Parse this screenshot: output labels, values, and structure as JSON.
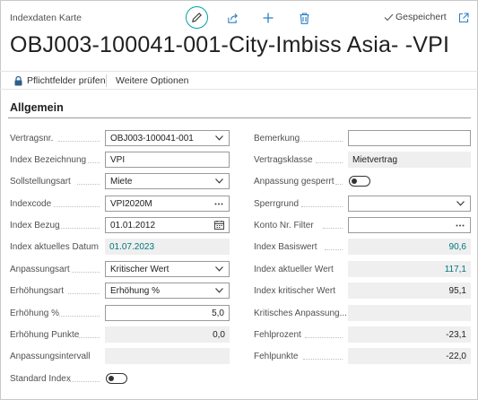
{
  "header": {
    "caption": "Indexdaten Karte",
    "saved_status": "Gespeichert",
    "title": "OBJ003-100041-001-City-Imbiss Asia- -VPI"
  },
  "actions": {
    "check_required": "Pflichtfelder prüfen",
    "more_options": "Weitere Optionen"
  },
  "group": {
    "title": "Allgemein"
  },
  "left_fields": {
    "vertragsnr": {
      "label": "Vertragsnr.",
      "value": "OBJ003-100041-001"
    },
    "index_bezeichnung": {
      "label": "Index Bezeichnung",
      "value": "VPI"
    },
    "sollstellungsart": {
      "label": "Sollstellungsart",
      "value": "Miete"
    },
    "indexcode": {
      "label": "Indexcode",
      "value": "VPI2020M"
    },
    "index_bezug": {
      "label": "Index Bezug",
      "value": "01.01.2012"
    },
    "index_aktuelles_datum": {
      "label": "Index aktuelles Datum",
      "value": "01.07.2023"
    },
    "anpassungsart": {
      "label": "Anpassungsart",
      "value": "Kritischer Wert"
    },
    "erhoehungsart": {
      "label": "Erhöhungsart",
      "value": "Erhöhung %"
    },
    "erhoehung_prozent": {
      "label": "Erhöhung %",
      "value": "5,0"
    },
    "erhoehung_punkte": {
      "label": "Erhöhung Punkte",
      "value": "0,0"
    },
    "anpassungsintervall": {
      "label": "Anpassungsintervall",
      "value": ""
    },
    "standard_index": {
      "label": "Standard Index",
      "value": false
    }
  },
  "right_fields": {
    "bemerkung": {
      "label": "Bemerkung",
      "value": ""
    },
    "vertragsklasse": {
      "label": "Vertragsklasse",
      "value": "Mietvertrag"
    },
    "anpassung_gesperrt": {
      "label": "Anpassung gesperrt",
      "value": false
    },
    "sperrgrund": {
      "label": "Sperrgrund",
      "value": ""
    },
    "konto_nr_filter": {
      "label": "Konto Nr. Filter",
      "value": ""
    },
    "index_basiswert": {
      "label": "Index Basiswert",
      "value": "90,6"
    },
    "index_aktueller_wert": {
      "label": "Index aktueller Wert",
      "value": "117,1"
    },
    "index_kritischer_wert": {
      "label": "Index kritischer Wert",
      "value": "95,1"
    },
    "kritisches_anpassung": {
      "label": "Kritisches Anpassung...",
      "value": ""
    },
    "fehlprozent": {
      "label": "Fehlprozent",
      "value": "-23,1"
    },
    "fehlpunkte": {
      "label": "Fehlpunkte",
      "value": "-22,0"
    }
  },
  "icons": {
    "edit": "pencil-icon",
    "share": "share-icon",
    "new": "plus-icon",
    "delete": "trash-icon",
    "saved": "check-icon",
    "open_new_window": "open-in-new-window-icon",
    "dropdown": "chevron-down-icon",
    "lookup": "ellipsis-icon",
    "calendar": "calendar-icon",
    "lock": "lock-icon"
  },
  "colors": {
    "accent": "#00a3a3",
    "link": "#00767c",
    "readonly_bg": "#efefef"
  }
}
